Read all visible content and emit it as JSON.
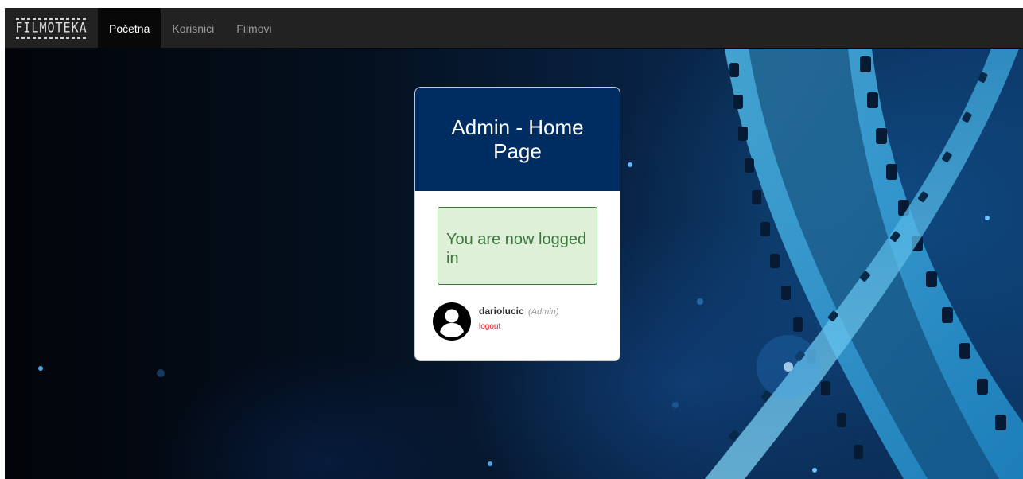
{
  "navbar": {
    "brand": "FILMOTEKA",
    "items": [
      {
        "label": "Početna",
        "active": true
      },
      {
        "label": "Korisnici",
        "active": false
      },
      {
        "label": "Filmovi",
        "active": false
      }
    ]
  },
  "card": {
    "title": "Admin - Home Page",
    "alert": "You are now logged in",
    "user": {
      "username": "dariolucic",
      "role": "(Admin)",
      "logout_label": "logout",
      "avatar_icon": "user-circle-icon"
    }
  },
  "colors": {
    "navbar_bg": "#222222",
    "card_header": "#002d61",
    "alert_bg": "#dff0d8",
    "alert_text": "#3c763d",
    "logout": "#d9201e"
  }
}
